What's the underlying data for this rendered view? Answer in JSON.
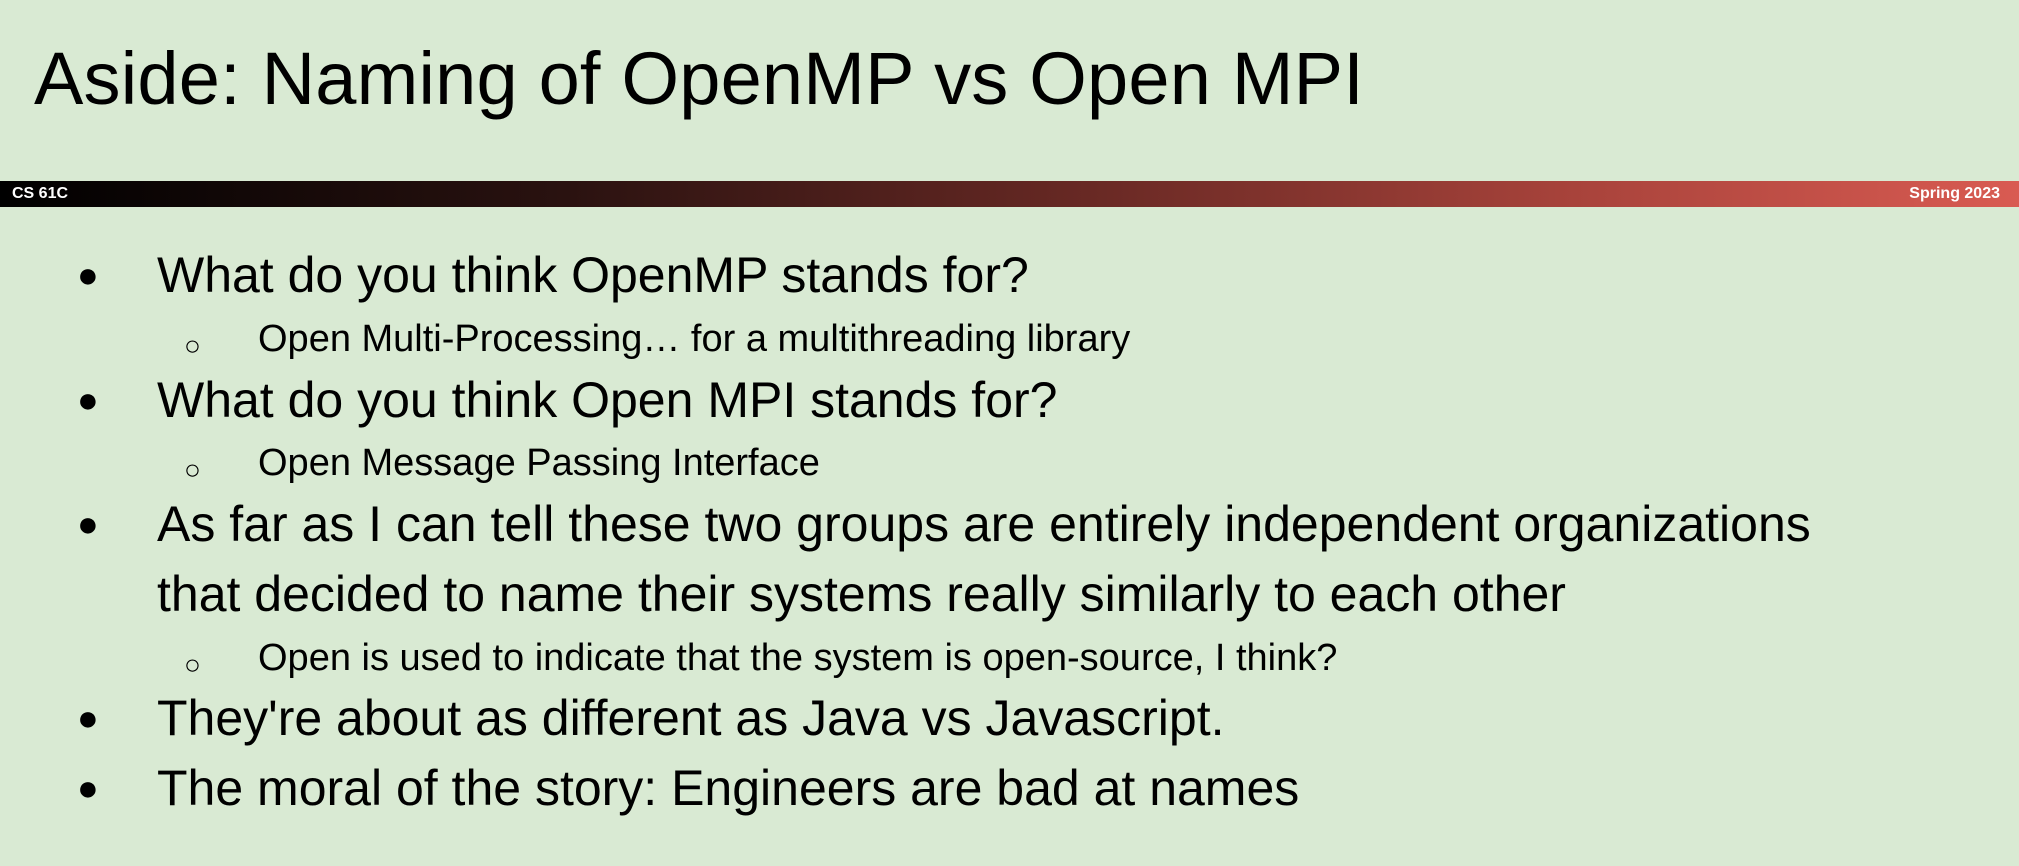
{
  "slide": {
    "title": "Aside: Naming of OpenMP vs Open MPI",
    "banner": {
      "left_label": "CS 61C",
      "right_label": "Spring 2023"
    },
    "bullets": [
      {
        "level": 1,
        "marker": "●",
        "text": "What do you think OpenMP stands for?"
      },
      {
        "level": 2,
        "marker": "○",
        "text": "Open Multi-Processing… for a multithreading library"
      },
      {
        "level": 1,
        "marker": "●",
        "text": "What do you think Open MPI stands for?"
      },
      {
        "level": 2,
        "marker": "○",
        "text": "Open Message Passing Interface"
      },
      {
        "level": 1,
        "marker": "●",
        "text": "As far as I can tell these two groups are entirely independent organizations"
      },
      {
        "level": 1,
        "marker": "",
        "text": "that decided to name their systems really similarly to each other"
      },
      {
        "level": 2,
        "marker": "○",
        "text": "Open is used to indicate that the system is open-source, I think?"
      },
      {
        "level": 1,
        "marker": "●",
        "text": "They're about as different as Java vs Javascript."
      },
      {
        "level": 1,
        "marker": "●",
        "text": "The moral of the story: Engineers are bad at names"
      }
    ]
  }
}
